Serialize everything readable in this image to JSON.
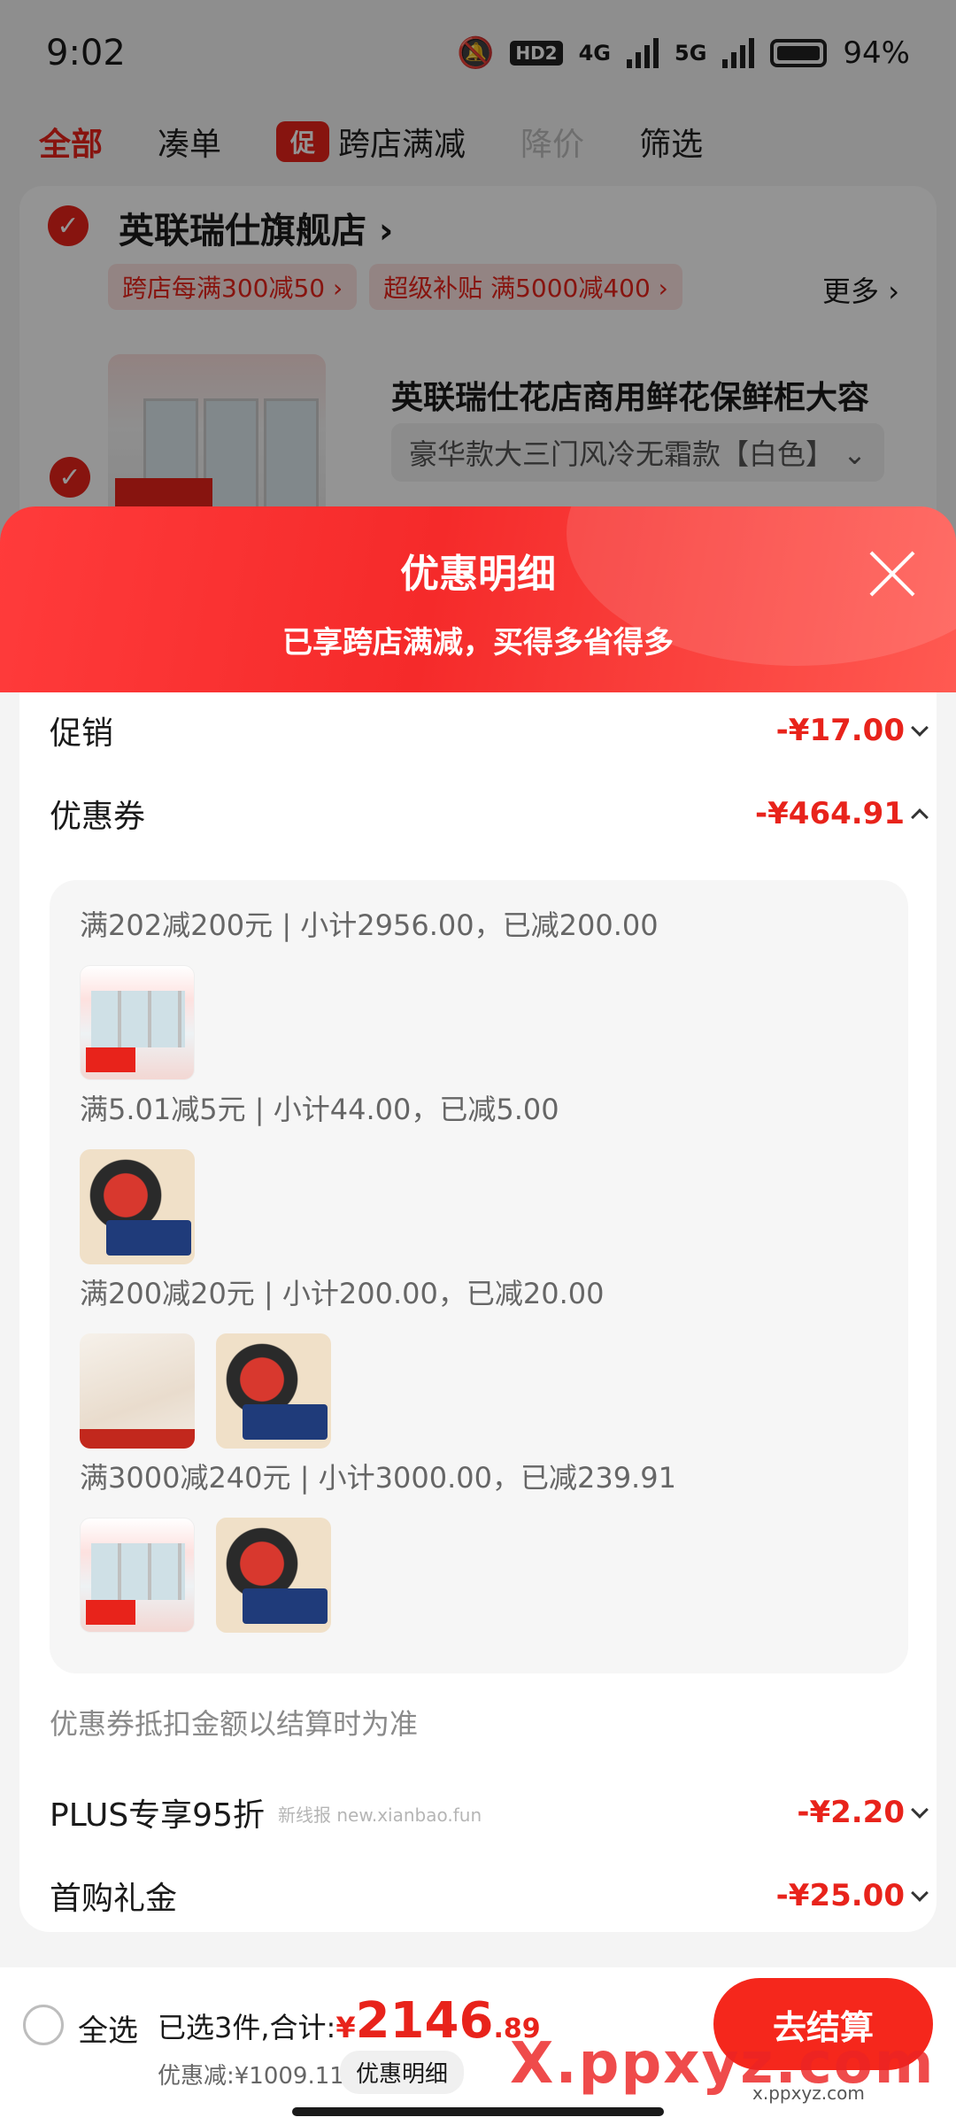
{
  "status_bar": {
    "time": "9:02",
    "battery": "94%",
    "net1": "4G",
    "net2": "5G",
    "hd": "HD2"
  },
  "tabs": [
    {
      "label": "全部"
    },
    {
      "label": "凑单"
    },
    {
      "label": "跨店满减",
      "chip": "促"
    },
    {
      "label": "降价"
    },
    {
      "label": "筛选"
    }
  ],
  "store": {
    "name": "英联瑞仕旗舰店 ›",
    "tags": [
      "跨店每满300减50 ›",
      "超级补贴 满5000减400 ›"
    ],
    "more": "更多 ›",
    "product_title": "英联瑞仕花店商用鲜花保鲜柜大容",
    "product_variant": "豪华款大三门风冷无霜款【白色】 ⌄"
  },
  "sheet": {
    "title": "优惠明细",
    "subtitle": "已享跨店满减，买得多省得多",
    "promo": {
      "label": "促销",
      "value": "-¥17.00"
    },
    "coupon": {
      "label": "优惠券",
      "value": "-¥464.91"
    },
    "coupon_lines": [
      "满202减200元 | 小计2956.00，已减200.00",
      "满5.01减5元 | 小计44.00，已减5.00",
      "满200减20元 | 小计200.00，已减20.00",
      "满3000减240元 | 小计3000.00，已减239.91"
    ],
    "note": "优惠券抵扣金额以结算时为准",
    "plus": {
      "label": "PLUS专享95折",
      "value": "-¥2.20"
    },
    "gift": {
      "label": "首购礼金",
      "value": "-¥25.00"
    },
    "inline_watermark": "新线报 new.xianbao.fun"
  },
  "bottom": {
    "select_all": "全选",
    "selected_label": "已选3件,合计:",
    "currency": "¥",
    "total_int": "2146",
    "total_dec": ".89",
    "saved": "优惠减:¥1009.11",
    "detail_button": "优惠明细",
    "checkout": "去结算"
  },
  "watermark": {
    "brand": "X.ppxyz.com",
    "url": "x.ppxyz.com"
  },
  "colors": {
    "accent": "#e8231b",
    "header_gradient_start": "#ff3b3b",
    "header_gradient_end": "#ff5a52"
  }
}
